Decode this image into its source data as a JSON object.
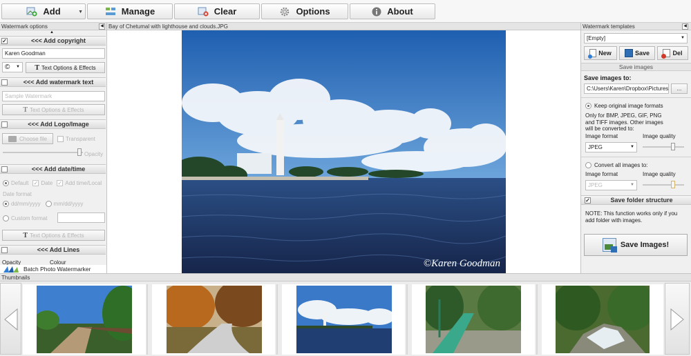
{
  "toolbar": {
    "add": "Add",
    "manage": "Manage",
    "clear": "Clear",
    "options": "Options",
    "about": "About"
  },
  "left": {
    "title": "Watermark options",
    "copyright": {
      "header": "<<< Add copyright",
      "value": "Karen Goodman",
      "symbol": "©",
      "text_options": "Text Options & Effects"
    },
    "watermark_text": {
      "header": "<<< Add watermark text",
      "placeholder": "Sample Watermark",
      "text_options": "Text Options & Effects"
    },
    "logo": {
      "header": "<<< Add Logo/Image",
      "choose": "Choose file",
      "transparent": "Transparent",
      "opacity": "Opacity"
    },
    "datetime": {
      "header": "<<< Add date/time",
      "opt1": "Default",
      "opt2": "Date",
      "opt3": "Add time/Local",
      "date_format": "Date format",
      "fmt1": "dd/mm/yyyy",
      "fmt2": "mm/dd/yyyy",
      "custom": "Custom format",
      "text_options": "Text Options & Effects"
    },
    "lines": {
      "header": "<<< Add Lines",
      "opacity": "Opacity",
      "colour": "Colour"
    },
    "footer": "Batch Photo Watermarker"
  },
  "center": {
    "title": "Bay of Chetumal with lighthouse and clouds.JPG",
    "watermark": "©Karen Goodman"
  },
  "right": {
    "title": "Watermark templates",
    "template": "[Empty]",
    "new": "New",
    "save": "Save",
    "del": "Del",
    "save_images_header": "Save images",
    "save_to_label": "Save images to:",
    "save_path": "C:\\Users\\Karen\\Dropbox\\Pictures",
    "browse": "...",
    "keep_original": "Keep original image formats",
    "note1": "Only for BMP, JPEG, GIF, PNG and TIFF images. Other images will be converted to:",
    "image_format": "Image format",
    "image_quality": "Image quality",
    "format1": "JPEG",
    "convert_all": "Convert all images to:",
    "image_format2": "Image format",
    "image_quality2": "Image quality",
    "format2": "JPEG",
    "save_folder": "Save folder structure",
    "note2": "NOTE: This function works only if you add folder with images.",
    "save_button": "Save Images!"
  },
  "thumbnails": {
    "title": "Thumbnails"
  },
  "colors": {
    "accent_blue": "#1c6fb7",
    "panel_bg": "#f0f0f0"
  }
}
